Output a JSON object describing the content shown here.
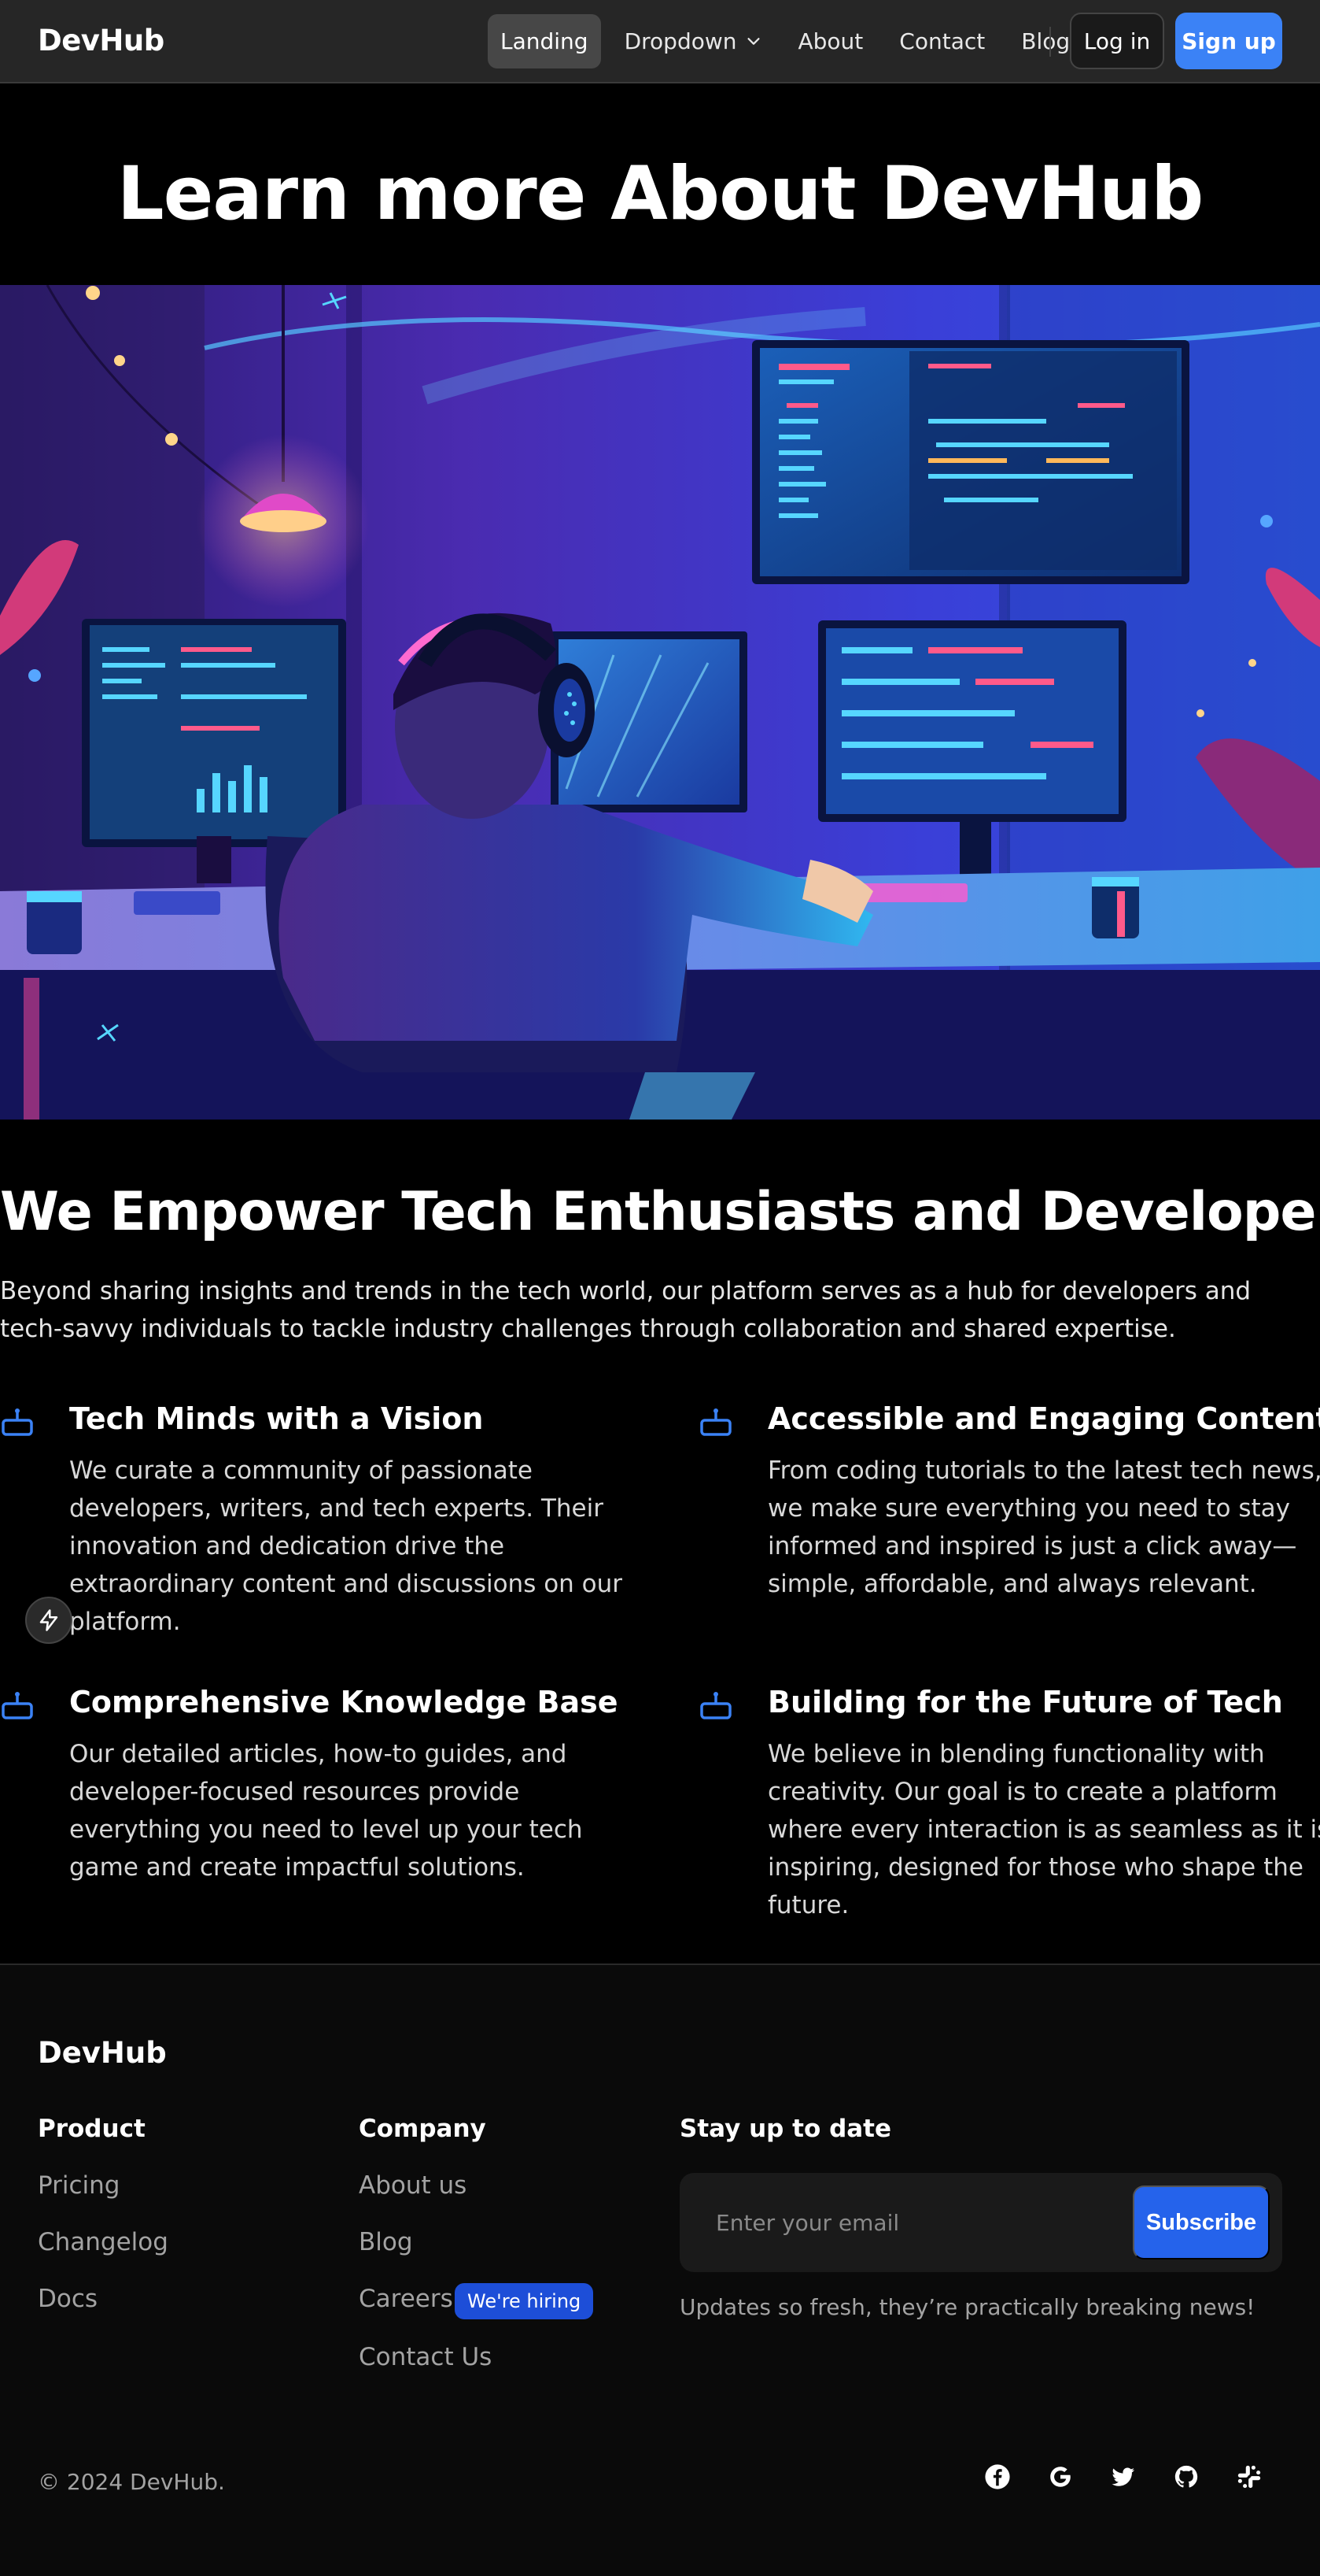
{
  "navbar": {
    "brand": "DevHub",
    "links": [
      {
        "label": "Landing",
        "active": true
      },
      {
        "label": "Dropdown",
        "has_chevron": true
      },
      {
        "label": "About"
      },
      {
        "label": "Contact"
      },
      {
        "label": "Blog"
      }
    ],
    "login_label": "Log in",
    "signup_label": "Sign up"
  },
  "hero": {
    "title": "Learn more About DevHub",
    "image_alt": "Illustration of a developer wearing headphones working at a desk with multiple glowing monitors in a neon-lit room"
  },
  "about": {
    "title": "We Empower Tech Enthusiasts and Developers",
    "text": "Beyond sharing insights and trends in the tech world, our platform serves as a hub for developers and tech-savvy individuals to tackle industry challenges through collaboration and shared expertise.",
    "features": [
      {
        "title": "Tech Minds with a Vision",
        "text": "We curate a community of passionate developers, writers, and tech experts. Their innovation and dedication drive the extraordinary content and discussions on our platform.",
        "icon": "robot-icon"
      },
      {
        "title": "Accessible and Engaging Content",
        "text": "From coding tutorials to the latest tech news, we make sure everything you need to stay informed and inspired is just a click away—simple, affordable, and always relevant.",
        "icon": "robot-icon"
      },
      {
        "title": "Comprehensive Knowledge Base",
        "text": "Our detailed articles, how-to guides, and developer-focused resources provide everything you need to level up your tech game and create impactful solutions.",
        "icon": "robot-icon"
      },
      {
        "title": "Building for the Future of Tech",
        "text": "We believe in blending functionality with creativity. Our goal is to create a platform where every interaction is as seamless as it is inspiring, designed for those who shape the future.",
        "icon": "robot-icon"
      }
    ]
  },
  "footer": {
    "brand": "DevHub",
    "product": {
      "title": "Product",
      "links": [
        "Pricing",
        "Changelog",
        "Docs"
      ]
    },
    "company": {
      "title": "Company",
      "links": [
        "About us",
        "Blog",
        "Careers",
        "Contact Us"
      ],
      "hiring_badge": "We're hiring"
    },
    "newsletter": {
      "title": "Stay up to date",
      "placeholder": "Enter your email",
      "button_label": "Subscribe",
      "note": "Updates so fresh, they’re practically breaking news!"
    },
    "copyright": "© 2024 DevHub.",
    "socials": [
      "facebook-icon",
      "google-icon",
      "twitter-icon",
      "github-icon",
      "slack-icon"
    ]
  },
  "colors": {
    "accent": "#3b82f6",
    "navbar_bg": "#262626",
    "page_bg": "#000000",
    "footer_bg": "#0a0a0a",
    "badge_bg": "#1d4ed8"
  }
}
